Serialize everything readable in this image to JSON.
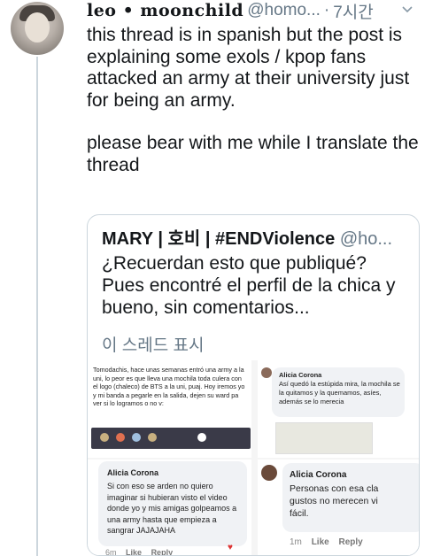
{
  "author": {
    "display_name": "leo • moonchild",
    "handle": "@homo...",
    "separator": "·",
    "time": "7시간"
  },
  "tweet": {
    "paragraphs": [
      "this thread is in spanish but the post is explaining some exols / kpop fans attacked an army at their university just for being an army.",
      "please bear with me while I translate the thread"
    ]
  },
  "quoted": {
    "name": "MARY | 호비 | #ENDViolence",
    "handle": "@ho...",
    "text": "¿Recuerdan esto que publiqué? Pues encontré el perfil de la chica y bueno, sin comentarios...",
    "show_thread": "이 스레드 표시"
  },
  "media": {
    "panel1_text": "Tomodachis, hace unas semanas entró una army a la uni, lo peor es que lleva una mochila toda culera con el logo (chaleco) de BTS a la uni, puaj. Hoy iremos yo y mi banda a pegarle en la salida, dejen su ward pa ver si lo logramos o no v:",
    "panel2_name": "Alicia Corona",
    "panel2_text": "Así quedó la estúpida mira, la mochila se la quitamos y la quemamos, asíes, además se lo merecia",
    "panel3_name": "Alicia Corona",
    "panel3_text": "Si con eso se arden no quiero imaginar si hubieran visto el video donde yo y mis amigas golpeamos a una army hasta que empieza a sangrar JAJAJAHA",
    "panel3_meta_time": "6m",
    "panel3_meta_like": "Like",
    "panel3_meta_reply": "Reply",
    "panel4_name": "Alicia Corona",
    "panel4_text": "Personas con esa cla gustos no merecen vi fácil.",
    "panel4_line1": "Personas con esa cla",
    "panel4_line2": "gustos no merecen vi",
    "panel4_line3": "fácil.",
    "panel4_meta_time": "1m",
    "panel4_meta_like": "Like",
    "panel4_meta_reply": "Reply"
  }
}
